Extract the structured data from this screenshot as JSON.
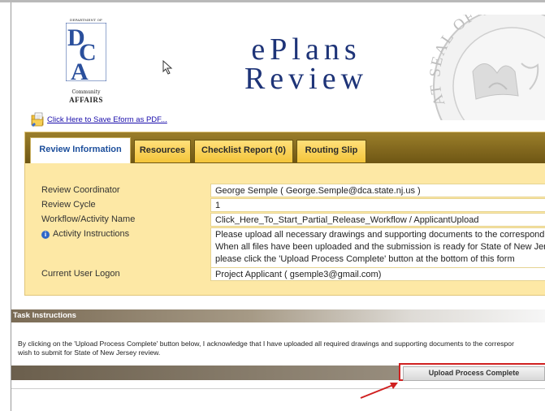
{
  "header": {
    "logo": {
      "dept_label": "DEPARTMENT OF",
      "letters": "DCA",
      "community": "Community",
      "affairs": "AFFAIRS"
    },
    "title_line1": "ePlans",
    "title_line2": "Review",
    "seal_text": "AT SEAL OF THE",
    "pdf_link": "Click Here to Save Eform as PDF..."
  },
  "tabs": [
    {
      "label": "Review Information",
      "active": true
    },
    {
      "label": "Resources",
      "active": false
    },
    {
      "label": "Checklist Report (0)",
      "active": false
    },
    {
      "label": "Routing Slip",
      "active": false
    }
  ],
  "fields": {
    "review_coordinator": {
      "label": "Review Coordinator",
      "value": "George Semple  ( George.Semple@dca.state.nj.us )"
    },
    "review_cycle": {
      "label": "Review Cycle",
      "value": "1"
    },
    "workflow": {
      "label": "Workflow/Activity Name",
      "value": "Click_Here_To_Start_Partial_Release_Workflow / ApplicantUpload"
    },
    "activity_instructions": {
      "label": "Activity Instructions",
      "line1": "Please upload all necessary drawings and supporting documents to the correspondi",
      "line2": "When all files have been uploaded and the submission is ready for State of New Jers",
      "line3": "please click the 'Upload Process Complete' button at the bottom of this form"
    },
    "current_user": {
      "label": "Current User Logon",
      "value": "Project Applicant ( gsemple3@gmail.com)"
    }
  },
  "task": {
    "heading": "Task Instructions",
    "line1": "By clicking on the 'Upload Process Complete' button below, I acknowledge that I have uploaded all required drawings and supporting documents to the correspor",
    "line2": "wish to submit for State of New Jersey review.",
    "button_label": "Upload Process Complete"
  },
  "colors": {
    "title_blue": "#1e3478",
    "panel_bg": "#fde8a5",
    "tab_gold": "#f3c53a",
    "highlight_red": "#d02020"
  },
  "icons": [
    "pdf-save-icon",
    "info-icon",
    "mouse-cursor-icon",
    "red-arrow-annotation"
  ]
}
